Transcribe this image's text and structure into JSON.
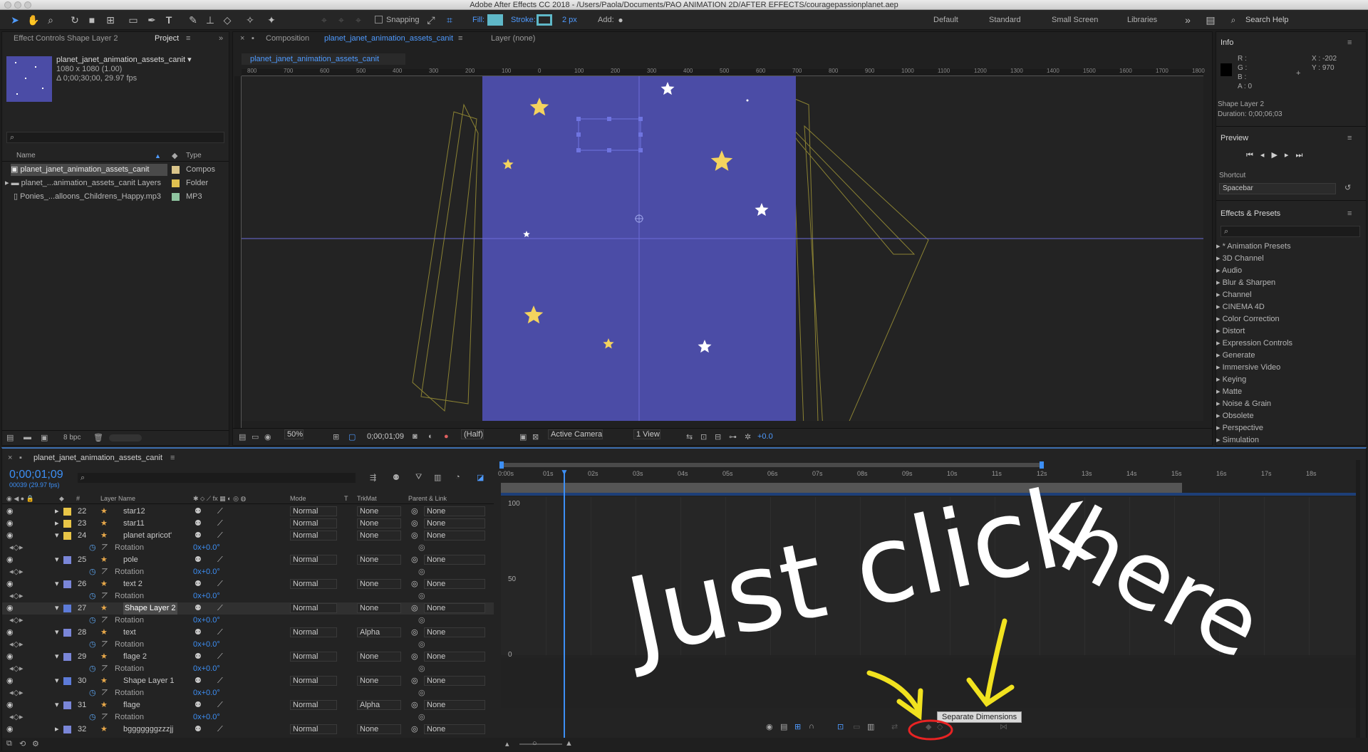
{
  "window": {
    "title": "Adobe After Effects CC 2018 - /Users/Paola/Documents/PAO ANIMATION 2D/AFTER EFFECTS/couragepassionplanet.aep"
  },
  "toolbar": {
    "snapping_label": "Snapping",
    "fill_label": "Fill:",
    "stroke_label": "Stroke:",
    "stroke_width": "2 px",
    "add_label": "Add:",
    "workspaces": [
      "Default",
      "Standard",
      "Small Screen",
      "Libraries"
    ],
    "search_placeholder": "Search Help",
    "colors": {
      "fill": "#5fb8c8",
      "stroke": "#5fb8c8"
    }
  },
  "project_panel": {
    "tab_effect_controls": "Effect Controls Shape Layer 2",
    "tab_project": "Project",
    "thumb_name": "planet_janet_animation_assets_canit ▾",
    "thumb_size": "1080 x 1080 (1.00)",
    "thumb_duration": "Δ 0;00;30;00, 29.97 fps",
    "col_name": "Name",
    "col_type": "Type",
    "items": [
      {
        "name": "planet_janet_animation_assets_canit",
        "type": "Compos",
        "color": "#d9c48a"
      },
      {
        "name": "planet_...animation_assets_canit Layers",
        "type": "Folder",
        "color": "#e0c050"
      },
      {
        "name": "Ponies_...alloons_Childrens_Happy.mp3",
        "type": "MP3",
        "color": "#8fc5a0"
      }
    ],
    "bpc": "8 bpc"
  },
  "composition_panel": {
    "tab_prefix": "Composition",
    "tab_name": "planet_janet_animation_assets_canit",
    "layer_tab": "Layer (none)",
    "subtab": "planet_janet_animation_assets_canit",
    "ruler_labels": [
      "800",
      "700",
      "600",
      "500",
      "400",
      "300",
      "200",
      "100",
      "0",
      "100",
      "200",
      "300",
      "400",
      "500",
      "600",
      "700",
      "800",
      "900",
      "1000",
      "1100",
      "1200",
      "1300",
      "1400",
      "1500",
      "1600",
      "1700",
      "1800"
    ],
    "zoom": "50%",
    "timecode": "0;00;01;09",
    "resolution": "(Half)",
    "camera": "Active Camera",
    "view": "1 View",
    "exposure": "+0.0",
    "colors": {
      "canvas": "#4b4ca6",
      "star": "#f4d35e"
    }
  },
  "info_panel": {
    "title": "Info",
    "r": "R :",
    "g": "G :",
    "b": "B :",
    "a": "A : 0",
    "x": "X : -202",
    "y": "Y : 970",
    "layer": "Shape Layer 2",
    "duration": "Duration: 0;00;06;03"
  },
  "preview_panel": {
    "title": "Preview",
    "shortcut_label": "Shortcut",
    "shortcut_value": "Spacebar"
  },
  "effects_panel": {
    "title": "Effects & Presets",
    "items": [
      "* Animation Presets",
      "3D Channel",
      "Audio",
      "Blur & Sharpen",
      "Channel",
      "CINEMA 4D",
      "Color Correction",
      "Distort",
      "Expression Controls",
      "Generate",
      "Immersive Video",
      "Keying",
      "Matte",
      "Noise & Grain",
      "Obsolete",
      "Perspective",
      "Simulation"
    ]
  },
  "timeline": {
    "tab": "planet_janet_animation_assets_canit",
    "timecode": "0;00;01;09",
    "frames": "00039 (29.97 fps)",
    "headers": {
      "layer_name": "Layer Name",
      "mode": "Mode",
      "t": "T",
      "trkmat": "TrkMat",
      "parent": "Parent & Link"
    },
    "ruler": [
      "0:00s",
      "01s",
      "02s",
      "03s",
      "04s",
      "05s",
      "06s",
      "07s",
      "08s",
      "09s",
      "10s",
      "11s",
      "12s",
      "13s",
      "14s",
      "15s",
      "16s",
      "17s",
      "18s"
    ],
    "graph_values": [
      "100",
      "50",
      "0"
    ],
    "rows": [
      {
        "kind": "layer",
        "num": "22",
        "name": "star12",
        "color": "#e8c547",
        "mode": "Normal",
        "trk": "None",
        "parent": "None"
      },
      {
        "kind": "layer",
        "num": "23",
        "name": "star11",
        "color": "#e8c547",
        "mode": "Normal",
        "trk": "None",
        "parent": "None"
      },
      {
        "kind": "layer",
        "num": "24",
        "name": "planet apricot'",
        "color": "#e8c547",
        "mode": "Normal",
        "trk": "None",
        "parent": "None"
      },
      {
        "kind": "prop",
        "name": "Rotation",
        "value": "0x+0.0°"
      },
      {
        "kind": "layer",
        "num": "25",
        "name": "pole",
        "color": "#7a86d8",
        "mode": "Normal",
        "trk": "None",
        "parent": "None"
      },
      {
        "kind": "prop",
        "name": "Rotation",
        "value": "0x+0.0°"
      },
      {
        "kind": "layer",
        "num": "26",
        "name": "text 2",
        "color": "#7a86d8",
        "mode": "Normal",
        "trk": "None",
        "parent": "None"
      },
      {
        "kind": "prop",
        "name": "Rotation",
        "value": "0x+0.0°"
      },
      {
        "kind": "layer",
        "num": "27",
        "name": "Shape Layer 2",
        "color": "#5d7bd8",
        "mode": "Normal",
        "trk": "None",
        "parent": "None",
        "selected": true
      },
      {
        "kind": "prop",
        "name": "Rotation",
        "value": "0x+0.0°"
      },
      {
        "kind": "layer",
        "num": "28",
        "name": "text",
        "color": "#7a86d8",
        "mode": "Normal",
        "trk": "Alpha",
        "parent": "None"
      },
      {
        "kind": "prop",
        "name": "Rotation",
        "value": "0x+0.0°"
      },
      {
        "kind": "layer",
        "num": "29",
        "name": "flage 2",
        "color": "#7a86d8",
        "mode": "Normal",
        "trk": "None",
        "parent": "None"
      },
      {
        "kind": "prop",
        "name": "Rotation",
        "value": "0x+0.0°"
      },
      {
        "kind": "layer",
        "num": "30",
        "name": "Shape Layer 1",
        "color": "#5d7bd8",
        "mode": "Normal",
        "trk": "None",
        "parent": "None"
      },
      {
        "kind": "prop",
        "name": "Rotation",
        "value": "0x+0.0°"
      },
      {
        "kind": "layer",
        "num": "31",
        "name": "flage",
        "color": "#7a86d8",
        "mode": "Normal",
        "trk": "Alpha",
        "parent": "None"
      },
      {
        "kind": "prop",
        "name": "Rotation",
        "value": "0x+0.0°"
      },
      {
        "kind": "layer",
        "num": "32",
        "name": "bgggggggzzzjj",
        "color": "#7a86d8",
        "mode": "Normal",
        "trk": "None",
        "parent": "None"
      }
    ]
  },
  "tooltip": {
    "text": "Separate Dimensions"
  },
  "annotation": {
    "line1": "Just click",
    "line2": "here"
  }
}
